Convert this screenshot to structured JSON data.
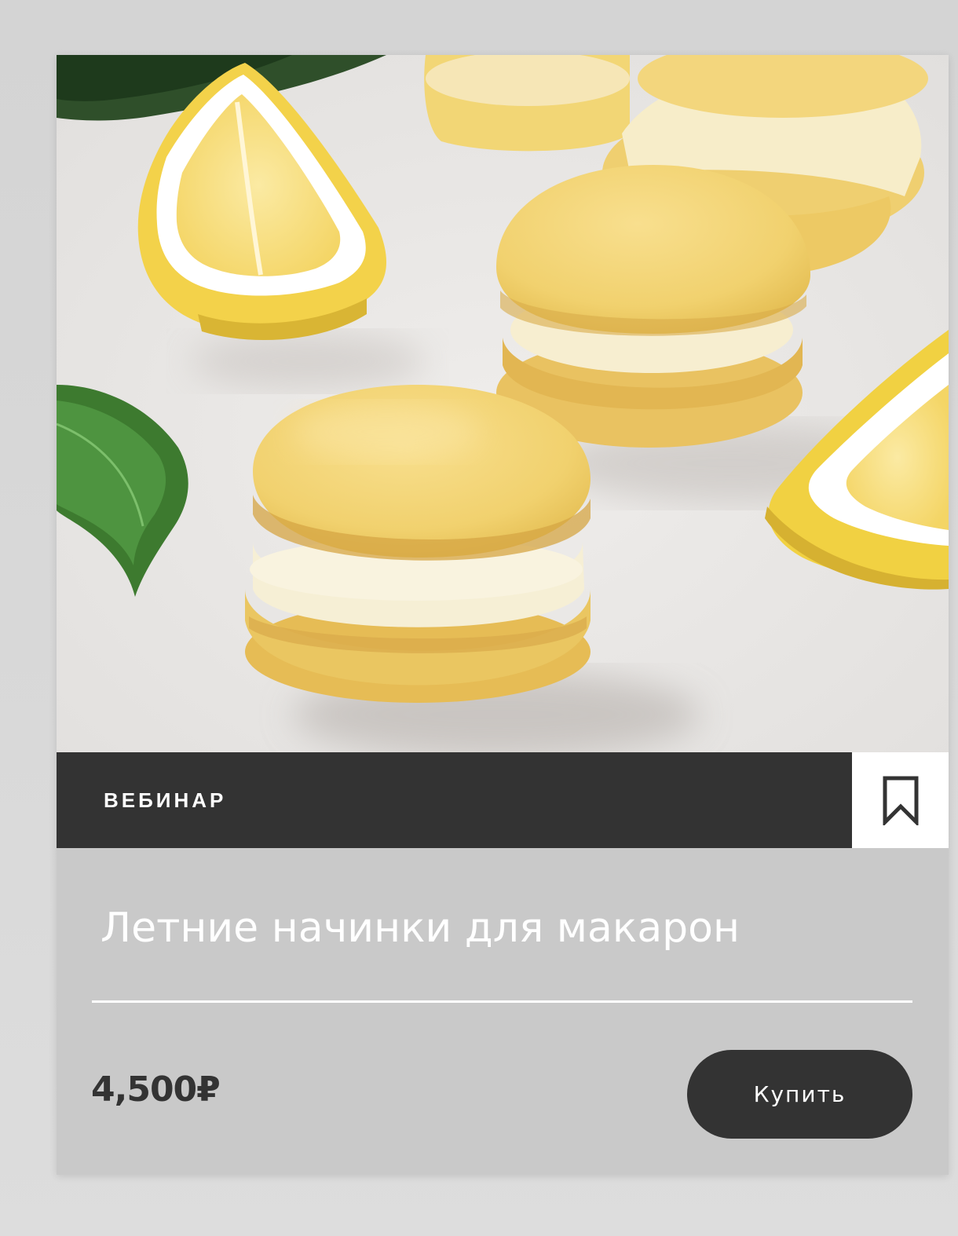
{
  "card": {
    "category_label": "ВЕБИНАР",
    "title": "Летние начинки для макарон",
    "price": "4,500₽",
    "buy_label": "Купить",
    "bookmark_icon": "bookmark-icon",
    "image_subject": "lemon-macarons-photo"
  },
  "colors": {
    "dark": "#333333",
    "card_bg": "#c9c9c9",
    "page_bg": "#d9d9d9",
    "white": "#ffffff"
  }
}
